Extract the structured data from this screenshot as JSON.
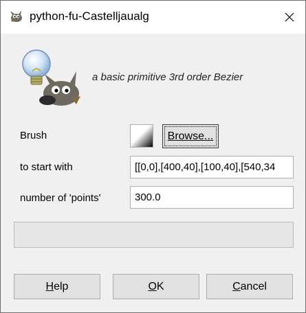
{
  "window": {
    "title": "python-fu-Castelljaualg",
    "icons": {
      "app": "gimp-wilber-icon",
      "close": "close-icon",
      "hero": "gimp-lightbulb-wilber-icon"
    }
  },
  "header": {
    "description": "a basic primitive 3rd order Bezier"
  },
  "fields": {
    "brush": {
      "label": "Brush",
      "browse_label": "Browse..."
    },
    "start": {
      "label": "to start with",
      "value": "[[0,0],[400,40],[100,40],[540,34"
    },
    "points": {
      "label": "number of 'points'",
      "value": "300.0"
    }
  },
  "progress": {
    "value": 0
  },
  "buttons": {
    "help": {
      "first": "H",
      "rest": "elp"
    },
    "ok": {
      "first": "O",
      "rest": "K"
    },
    "cancel": {
      "first": "C",
      "rest": "ancel"
    }
  },
  "colors": {
    "border": "#6b6b6b",
    "button_bg": "#e1e1e1",
    "dialog_bg": "#f0f0f0"
  }
}
